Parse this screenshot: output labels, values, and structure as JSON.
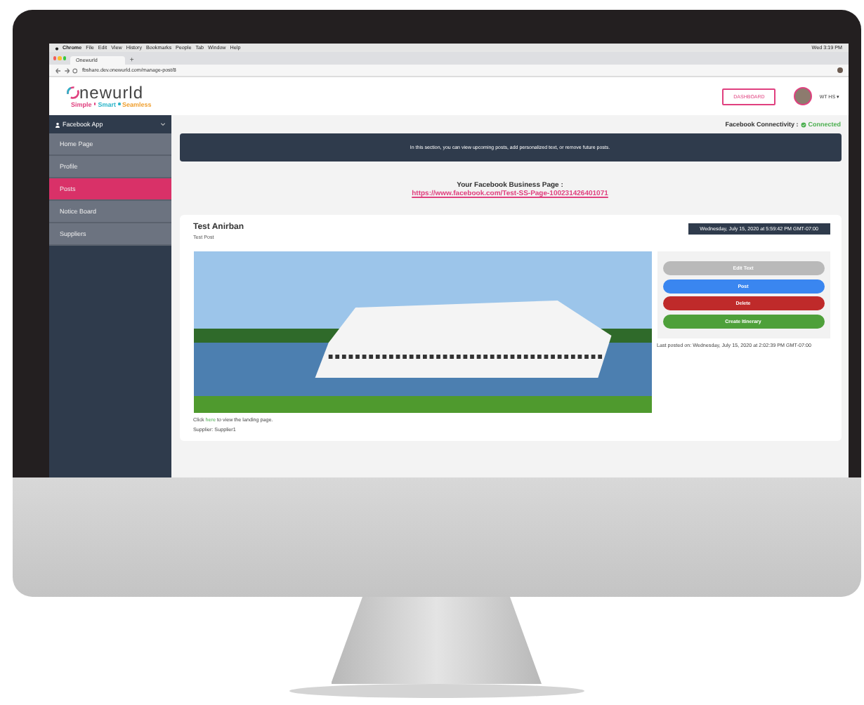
{
  "macos_menu_bar": {
    "items": [
      "Chrome",
      "File",
      "Edit",
      "View",
      "History",
      "Bookmarks",
      "People",
      "Tab",
      "Window",
      "Help"
    ],
    "clock": "Wed 3:19 PM"
  },
  "browser": {
    "tabs": [
      {
        "label": "Onewurld",
        "selected": true
      }
    ],
    "new_tab": "+",
    "url": "fbshare.dev.onewurld.com/manage-post/8"
  },
  "header": {
    "logo": "newurld",
    "tagline": [
      "Simple",
      "Smart",
      "Seamless"
    ],
    "dashboard_button": "DASHBOARD",
    "user": "WT HS ▾"
  },
  "sidebar": {
    "title": "Facebook App",
    "items": [
      {
        "label": "Home Page",
        "selected": false
      },
      {
        "label": "Profile",
        "selected": false
      },
      {
        "label": "Posts",
        "selected": true
      },
      {
        "label": "Notice Board",
        "selected": false
      },
      {
        "label": "Suppliers",
        "selected": false
      }
    ]
  },
  "connectivity": {
    "label": "Facebook Connectivity :",
    "status": "Connected"
  },
  "info_banner": "In this section, you can view upcoming posts, add personalized text, or remove future posts.",
  "business_page": {
    "label": "Your Facebook Business Page :",
    "link": "https://www.facebook.com/Test-SS-Page-100231426401071"
  },
  "post": {
    "title": "Test Anirban",
    "subtitle": "Test Post",
    "scheduled": "Wednesday, July 15, 2020 at 5:59:42 PM GMT-07:00",
    "landing_prefix": "Click",
    "landing_link": "here",
    "landing_suffix": "to view the landing page.",
    "supplier": "Supplier: Supplier1",
    "buttons": [
      {
        "label": "Edit Text",
        "kind": "edit"
      },
      {
        "label": "Post",
        "kind": "post"
      },
      {
        "label": "Delete",
        "kind": "delete"
      },
      {
        "label": "Create Itinerary",
        "kind": "itinerary"
      }
    ],
    "last_posted": "Last posted on: Wednesday, July 15, 2020 at 2:02:39 PM GMT-07:00"
  }
}
